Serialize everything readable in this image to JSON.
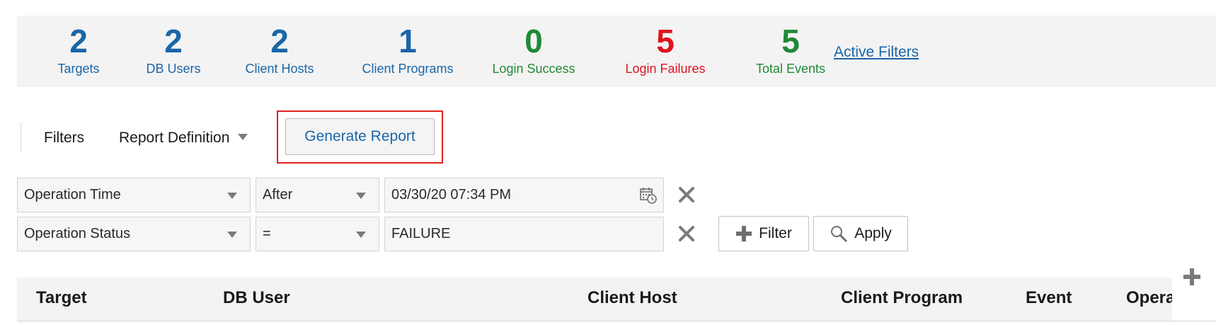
{
  "summary": {
    "stats": [
      {
        "value": "2",
        "label": "Targets",
        "color": "#1a66a8"
      },
      {
        "value": "2",
        "label": "DB Users",
        "color": "#1a66a8"
      },
      {
        "value": "2",
        "label": "Client Hosts",
        "color": "#1a66a8"
      },
      {
        "value": "1",
        "label": "Client Programs",
        "color": "#1a66a8"
      },
      {
        "value": "0",
        "label": "Login Success",
        "color": "#1f8a36"
      },
      {
        "value": "5",
        "label": "Login Failures",
        "color": "#e0141e"
      },
      {
        "value": "5",
        "label": "Total Events",
        "color": "#1f8a36"
      }
    ],
    "active_filters_link": "Active Filters"
  },
  "toolbar": {
    "filters_label": "Filters",
    "report_definition_label": "Report Definition",
    "generate_report_label": "Generate Report",
    "highlight_color": "#e0201d"
  },
  "filters": {
    "rows": [
      {
        "column": "Operation Time",
        "operator": "After",
        "value": "03/30/20 07:34 PM"
      },
      {
        "column": "Operation Status",
        "operator": "=",
        "value": "FAILURE"
      }
    ],
    "add_filter_label": "Filter",
    "apply_label": "Apply"
  },
  "table": {
    "columns": [
      "Target",
      "DB User",
      "Client Host",
      "Client Program",
      "Event",
      "Operation"
    ]
  },
  "icons": {
    "calendar": "calendar-icon",
    "remove": "close-icon",
    "add": "plus-icon",
    "search": "search-icon"
  }
}
